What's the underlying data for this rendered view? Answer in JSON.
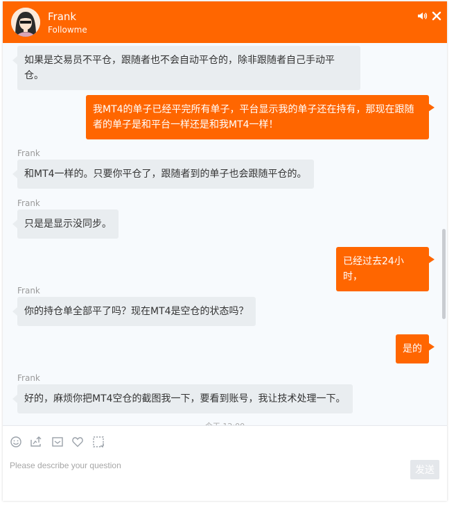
{
  "header": {
    "agent_name": "Frank",
    "company": "Followme",
    "avatar": "agent-avatar",
    "sound_icon": "speaker-icon",
    "close_icon": "close-icon"
  },
  "messages": {
    "m1": {
      "text": "如果是交易员不平仓，跟随者也不会自动平仓的，除非跟随者自己手动平仓。"
    },
    "m2": {
      "text": "我MT4的单子已经平完所有单子，平台显示我的单子还在持有，那现在跟随者的单子是和平台一样还是和我MT4一样！"
    },
    "m3": {
      "sender": "Frank",
      "text": "和MT4一样的。只要你平仓了，跟随者到的单子也会跟随平仓的。"
    },
    "m4": {
      "sender": "Frank",
      "text": "只是是显示没同步。"
    },
    "m5": {
      "text": "已经过去24小时，"
    },
    "m6": {
      "sender": "Frank",
      "text": "你的持仓单全部平了吗？现在MT4是空仓的状态吗？"
    },
    "m7": {
      "text": "是的"
    },
    "m8": {
      "sender": "Frank",
      "text": "好的，麻烦你把MT4空仓的截图我一下，要看到账号，我让技术处理一下。"
    },
    "timestamp_partial": "今天 12:00"
  },
  "composer": {
    "placeholder": "Please describe your question",
    "value": "",
    "send_label": "发送",
    "tools": [
      "emoji-icon",
      "image-upload-icon",
      "email-icon",
      "like-icon",
      "screenshot-icon"
    ]
  },
  "colors": {
    "brand": "#ff6600",
    "agent_bubble": "#e9edf0",
    "background": "#f7fafd"
  }
}
